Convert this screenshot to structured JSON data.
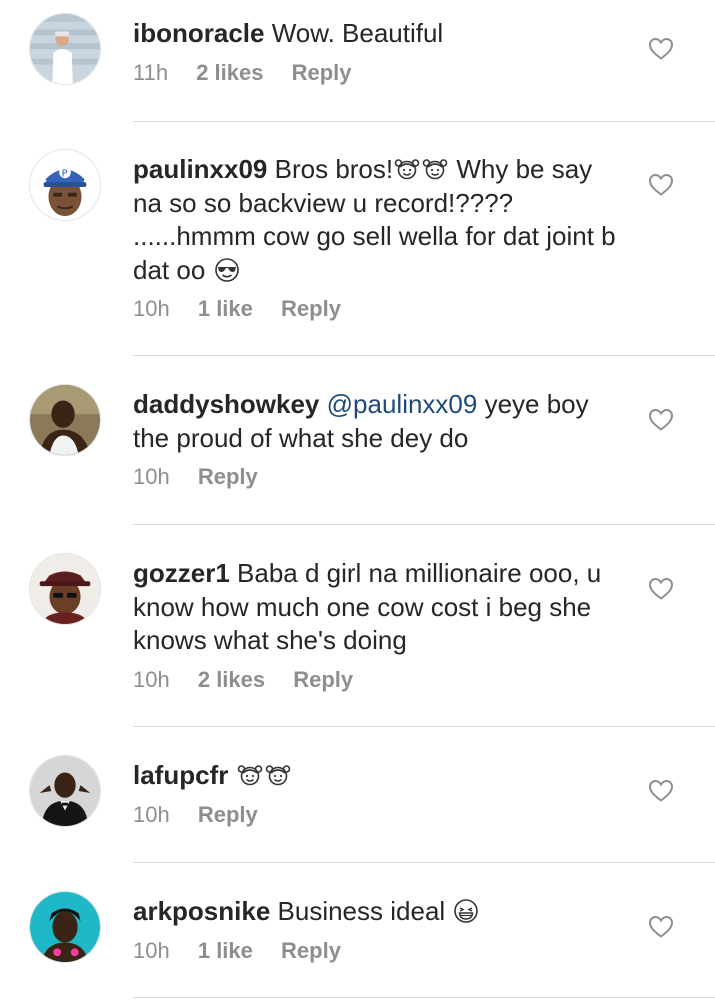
{
  "comments": [
    {
      "username": "ibonoracle",
      "text": " Wow. Beautiful",
      "time": "11h",
      "likes": "2 likes",
      "reply": "Reply"
    },
    {
      "username": "paulinxx09",
      "text1": " Bros bros!",
      "text2": " Why be say na so so backview u record!???? ......hmmm cow go sell wella for dat joint b dat oo",
      "time": "10h",
      "likes": "1 like",
      "reply": "Reply"
    },
    {
      "username": "daddyshowkey",
      "mention": "@paulinxx09",
      "text": " yeye boy the proud of what she dey do",
      "time": "10h",
      "reply": "Reply"
    },
    {
      "username": "gozzer1",
      "text": " Baba d girl na millionaire ooo, u know how much one cow cost i beg she knows what she's doing",
      "time": "10h",
      "likes": "2 likes",
      "reply": "Reply"
    },
    {
      "username": "lafupcfr",
      "time": "10h",
      "reply": "Reply"
    },
    {
      "username": "arkposnike",
      "text": " Business ideal",
      "time": "10h",
      "likes": "1 like",
      "reply": "Reply"
    }
  ],
  "icons": {
    "heart": "heart-outline-icon",
    "emoji_girl": "girl-emoji-icon",
    "emoji_sunglasses": "sunglasses-emoji-icon",
    "emoji_grin": "grinning-emoji-icon"
  },
  "colors": {
    "text": "#262626",
    "meta": "#8e8e8e",
    "mention": "#1e4b7a",
    "divider": "#dbdbdb"
  }
}
